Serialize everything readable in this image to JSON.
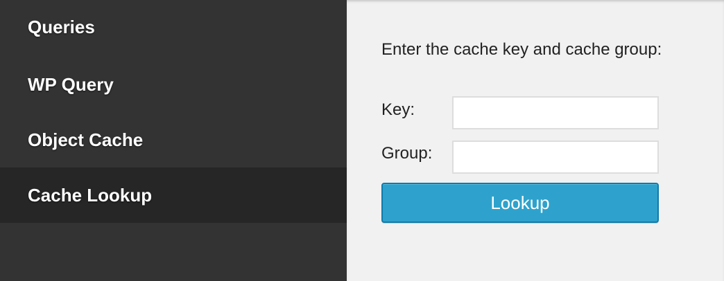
{
  "sidebar": {
    "items": [
      {
        "label": "Queries",
        "active": false
      },
      {
        "label": "WP Query",
        "active": false
      },
      {
        "label": "Object Cache",
        "active": false
      },
      {
        "label": "Cache Lookup",
        "active": true
      }
    ]
  },
  "main": {
    "intro": "Enter the cache key and cache group:",
    "key_label": "Key:",
    "key_value": "",
    "group_label": "Group:",
    "group_value": "",
    "lookup_label": "Lookup"
  },
  "colors": {
    "sidebar_bg": "#333333",
    "sidebar_active_bg": "#262626",
    "main_bg": "#f1f1f1",
    "button_bg": "#2ea2cc",
    "button_border": "#0e7bab"
  }
}
